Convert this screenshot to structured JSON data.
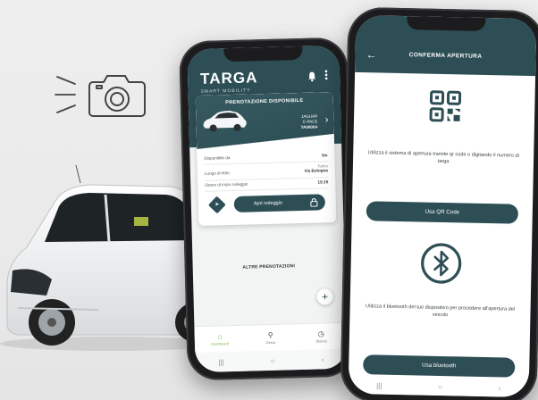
{
  "colors": {
    "primary": "#2d4e55",
    "active_nav": "#7ab648",
    "background": "#ececec"
  },
  "illustration": {
    "camera_icon": "camera-icon",
    "flash_lines_icon": "flash-lines-icon",
    "car_image": "white-electric-car"
  },
  "left_phone": {
    "logo": {
      "brand": "TARGA",
      "tagline": "SMART MOBILITY"
    },
    "header_icons": [
      "bell-icon",
      "more-vertical-icon"
    ],
    "reservation_card": {
      "title": "PRENOTAZIONE DISPONIBILE",
      "car_model_line1": "JAGUAR",
      "car_model_line2": "E-PACE",
      "plate": "TA0000A",
      "rows": [
        {
          "label": "Disponibile da",
          "value": "3m",
          "sub": ""
        },
        {
          "label": "Luogo di ritiro",
          "value": "Via Bologna",
          "sub": "Torino"
        },
        {
          "label": "Orario di inizio noleggio",
          "value": "15:15",
          "sub": ""
        }
      ],
      "open_button": "Apri noleggio"
    },
    "other_reservations_title": "ALTRE PRENOTAZIONI",
    "fab_label": "+",
    "bottom_nav": [
      {
        "label": "Dashboard",
        "icon": "home-icon"
      },
      {
        "label": "Cerca",
        "icon": "search-icon"
      },
      {
        "label": "Storico",
        "icon": "clock-icon"
      }
    ],
    "system_nav": [
      "|||",
      "○",
      "‹"
    ]
  },
  "right_phone": {
    "back_icon": "arrow-left-icon",
    "title": "CONFERMA APERTURA",
    "qr_text": "Utilizza il sistema di apertura tramite qr code o digitando il numero di targa",
    "qr_button": "Usa QR Code",
    "bt_text": "Utilizza il bluetooth del tuo dispositivo per procedere all'apertura del veicolo",
    "bt_button": "Usa bluetooth",
    "system_nav": [
      "|||",
      "○",
      "‹"
    ]
  }
}
